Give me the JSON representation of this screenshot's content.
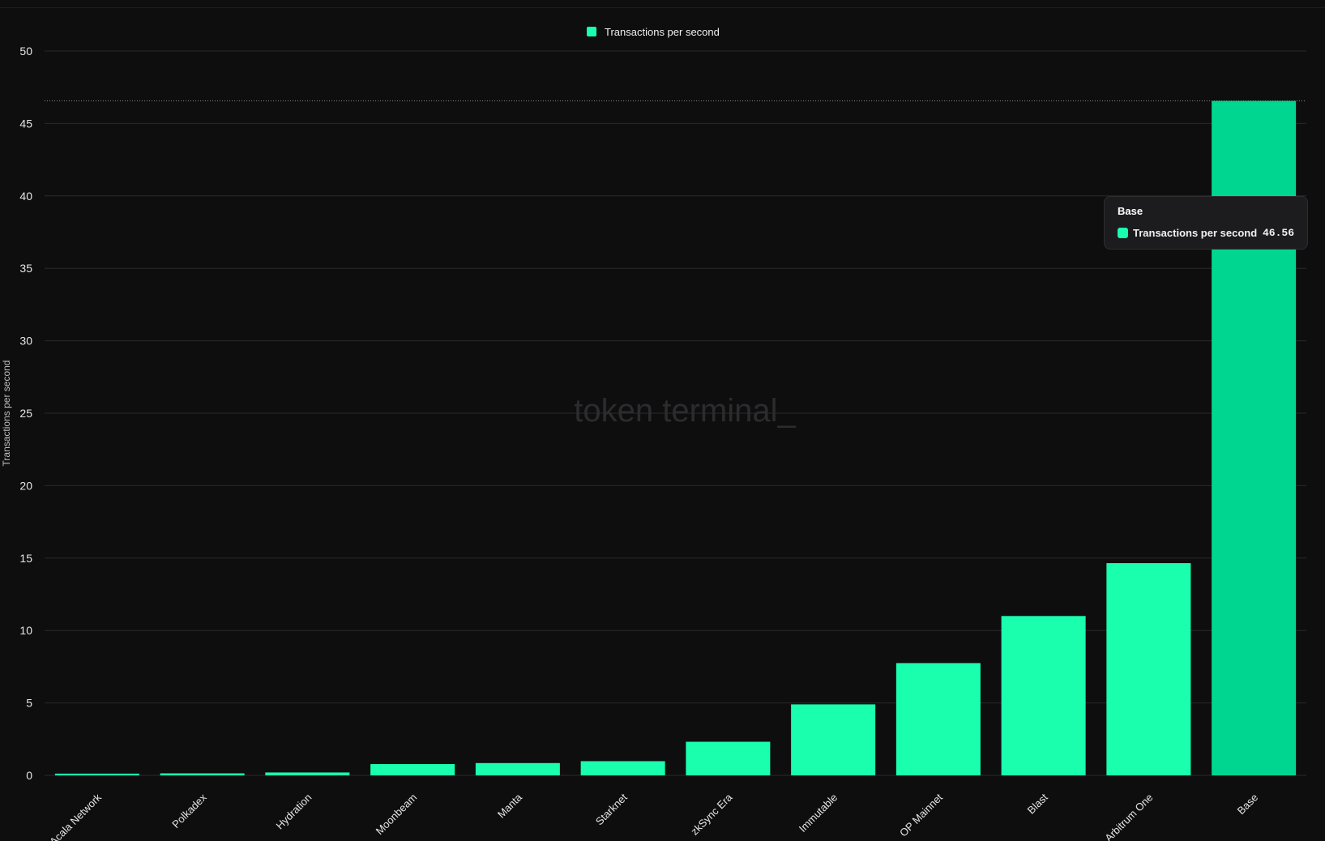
{
  "chart_data": {
    "type": "bar",
    "categories": [
      "Acala Network",
      "Polkadex",
      "Hydration",
      "Moonbeam",
      "Manta",
      "Starknet",
      "zkSync Era",
      "Immutable",
      "OP Mainnet",
      "Blast",
      "Arbitrum One",
      "Base"
    ],
    "series": [
      {
        "name": "Transactions per second",
        "values": [
          0.12,
          0.14,
          0.2,
          0.78,
          0.85,
          0.98,
          2.32,
          4.9,
          7.75,
          11.0,
          14.65,
          46.56
        ]
      }
    ],
    "ylabel": "Transactions per second",
    "ylim": [
      0,
      50
    ],
    "yticks": [
      "0",
      "5",
      "10",
      "15",
      "20",
      "25",
      "30",
      "35",
      "40",
      "45",
      "50"
    ],
    "grid": true,
    "legend_placement": "top-center",
    "highlighted_category": "Base",
    "colors": {
      "bar": "#1affae",
      "bar_highlight": "#00d68f",
      "background": "#0e0e0f",
      "grid": "#2a2a2c"
    }
  },
  "legend": {
    "label": "Transactions per second"
  },
  "watermark": "token terminal_",
  "tooltip": {
    "title": "Base",
    "series_label": "Transactions per second",
    "value": "46.56"
  }
}
